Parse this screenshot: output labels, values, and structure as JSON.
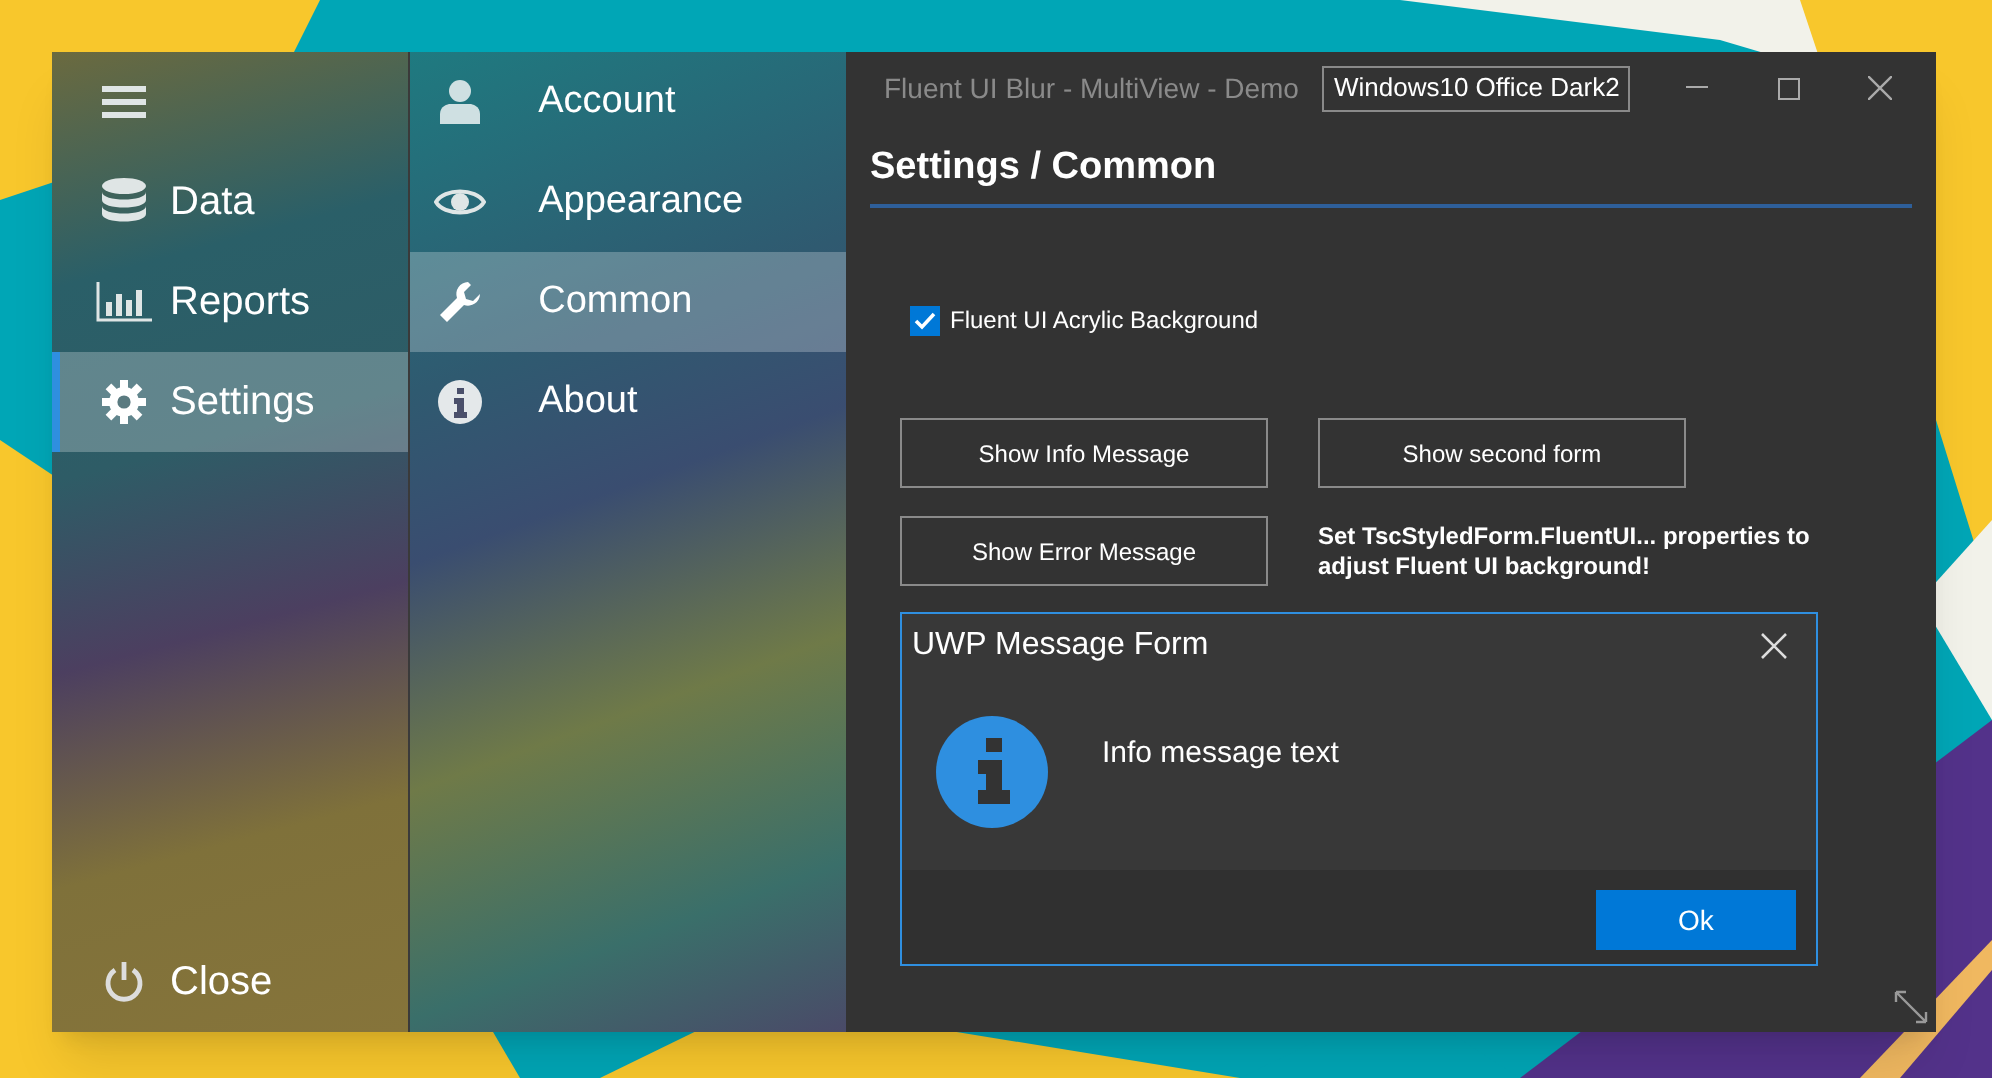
{
  "window": {
    "title": "Fluent UI Blur - MultiView - Demo"
  },
  "theme_combo": {
    "value": "Windows10 Office Dark2"
  },
  "sidebar": {
    "items": [
      {
        "label": "Data",
        "selected": false
      },
      {
        "label": "Reports",
        "selected": false
      },
      {
        "label": "Settings",
        "selected": true
      }
    ],
    "close_item": {
      "label": "Close"
    }
  },
  "submenu": {
    "items": [
      {
        "label": "Account",
        "selected": false
      },
      {
        "label": "Appearance",
        "selected": false
      },
      {
        "label": "Common",
        "selected": true
      },
      {
        "label": "About",
        "selected": false
      }
    ]
  },
  "heading": "Settings / Common",
  "checkbox": {
    "label": "Fluent UI Acrylic Background",
    "checked": true
  },
  "buttons": [
    "Show Info Message",
    "Show second form",
    "Show Error Message"
  ],
  "note": "Set TscStyledForm.FluentUI... properties to adjust Fluent UI background!",
  "dialog": {
    "title": "UWP Message Form",
    "message": "Info message text",
    "button": "Ok"
  }
}
